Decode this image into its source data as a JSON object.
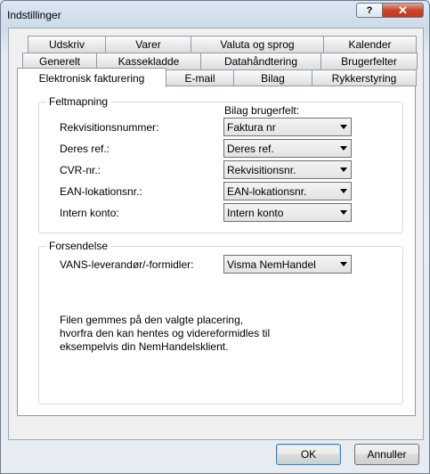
{
  "window": {
    "title": "Indstillinger",
    "help_glyph": "?",
    "close_glyph": "✕"
  },
  "tabs": {
    "row1": [
      "Udskriv",
      "Varer",
      "Valuta og sprog",
      "Kalender"
    ],
    "row2": [
      "Generelt",
      "Kassekladde",
      "Datahåndtering",
      "Brugerfelter"
    ],
    "row3": [
      "Elektronisk fakturering",
      "E-mail",
      "Bilag",
      "Rykkerstyring"
    ],
    "active": "Elektronisk fakturering"
  },
  "feltmapning": {
    "title": "Feltmapning",
    "column_header": "Bilag brugerfelt:",
    "rows": [
      {
        "label": "Rekvisitionsnummer:",
        "value": "Faktura nr"
      },
      {
        "label": "Deres ref.:",
        "value": "Deres ref."
      },
      {
        "label": "CVR-nr.:",
        "value": "Rekvisitionsnr."
      },
      {
        "label": "EAN-lokationsnr.:",
        "value": "EAN-lokationsnr."
      },
      {
        "label": "Intern konto:",
        "value": "Intern konto"
      }
    ]
  },
  "forsendelse": {
    "title": "Forsendelse",
    "vans_label": "VANS-leverandør/-formidler:",
    "vans_value": "Visma NemHandel",
    "info_lines": [
      "Filen gemmes på den valgte placering,",
      "hvorfra den kan hentes og videreformidles til",
      "eksempelvis din NemHandelsklient."
    ]
  },
  "buttons": {
    "ok": "OK",
    "cancel": "Annuller"
  }
}
